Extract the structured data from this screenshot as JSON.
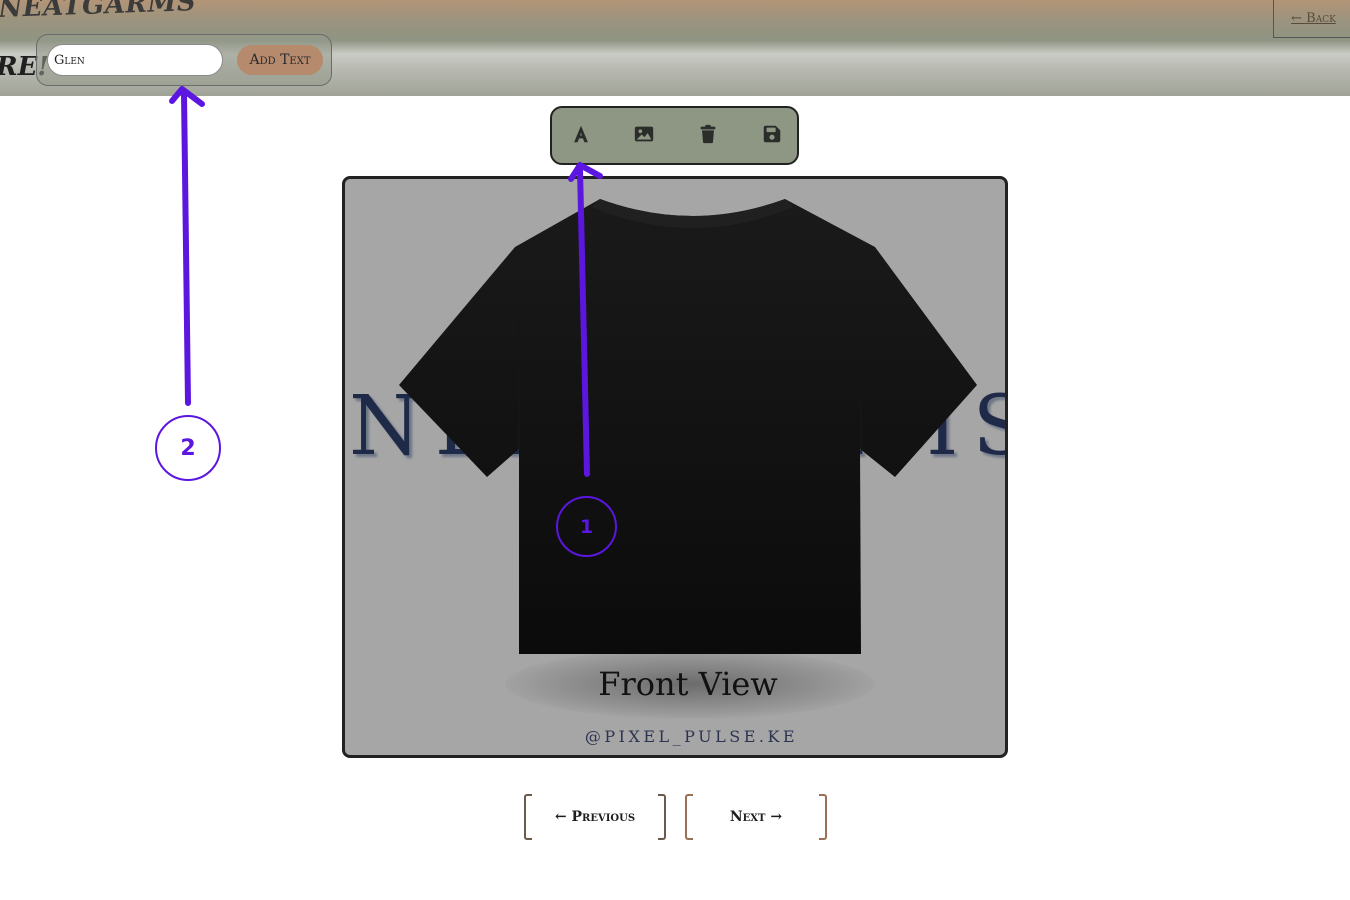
{
  "header": {
    "brand": "NEATGARMS",
    "tagline": "RE!",
    "back_label": "← Back"
  },
  "text_panel": {
    "input_value": "Glen",
    "add_button_label": "Add Text"
  },
  "toolbar": {
    "tools": [
      {
        "icon": "text-icon"
      },
      {
        "icon": "image-icon"
      },
      {
        "icon": "trash-icon"
      },
      {
        "icon": "save-icon"
      }
    ]
  },
  "canvas": {
    "background_text": "NEATGARMS",
    "view_label": "Front View",
    "credit": "@PIXEL_PULSE.KE"
  },
  "navigation": {
    "previous_label": "← Previous",
    "next_label": "Next →"
  },
  "annotations": {
    "markers": [
      "1",
      "2"
    ],
    "color": "#5b16e0"
  },
  "colors": {
    "add_button": "#b58a6d",
    "toolbar_bg": "#8e9684",
    "canvas_bg": "#a6a6a6"
  }
}
